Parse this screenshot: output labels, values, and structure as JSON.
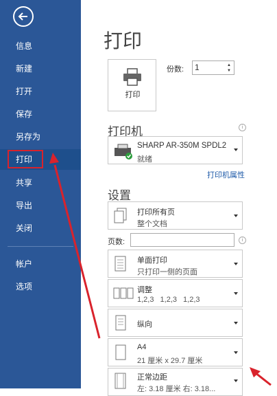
{
  "sidebar": {
    "items": [
      {
        "label": "信息"
      },
      {
        "label": "新建"
      },
      {
        "label": "打开"
      },
      {
        "label": "保存"
      },
      {
        "label": "另存为"
      },
      {
        "label": "打印"
      },
      {
        "label": "共享"
      },
      {
        "label": "导出"
      },
      {
        "label": "关闭"
      },
      {
        "label": "帐户"
      },
      {
        "label": "选项"
      }
    ],
    "active": "打印"
  },
  "main": {
    "title": "打印",
    "print_button": "打印",
    "copies": {
      "label": "份数:",
      "value": "1"
    },
    "printer_section": "打印机",
    "printer": {
      "name": "SHARP AR-350M SPDL2",
      "status": "就绪"
    },
    "printer_properties": "打印机属性",
    "settings_section": "设置",
    "settings": [
      {
        "title": "打印所有页",
        "subtitle": "整个文档"
      },
      {
        "title": "单面打印",
        "subtitle": "只打印一侧的页面"
      },
      {
        "title": "调整",
        "subtitle": "1,2,3    1,2,3    1,2,3"
      },
      {
        "title": "纵向",
        "subtitle": ""
      },
      {
        "title": "A4",
        "subtitle": "21 厘米 x 29.7 厘米"
      },
      {
        "title": "正常边距",
        "subtitle": "左: 3.18 厘米   右: 3.18..."
      }
    ],
    "pages_label": "页数:",
    "pages_value": ""
  },
  "colors": {
    "sidebar": "#2b5797",
    "active": "#1e4f8c",
    "highlight": "#d9232c",
    "link": "#1e5aa8"
  }
}
